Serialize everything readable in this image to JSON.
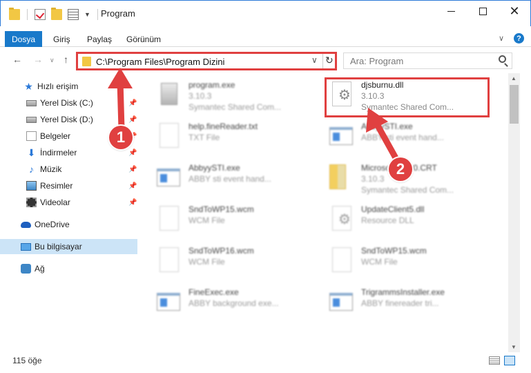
{
  "window": {
    "title": "Program",
    "minimize_label": "–",
    "maximize_label": "□",
    "close_label": "✕"
  },
  "ribbon": {
    "tabs": [
      {
        "label": "Dosya"
      },
      {
        "label": "Giriş"
      },
      {
        "label": "Paylaş"
      },
      {
        "label": "Görünüm"
      }
    ],
    "help_label": "?"
  },
  "nav": {
    "address": "C:\\Program Files\\Program Dizini",
    "search_placeholder": "Ara: Program"
  },
  "sidebar": {
    "items": [
      {
        "label": "Hızlı erişim",
        "icon": "star-icon"
      },
      {
        "label": "Yerel Disk (C:)",
        "icon": "disk-icon",
        "pinned": true
      },
      {
        "label": "Yerel Disk (D:)",
        "icon": "disk-icon",
        "pinned": true
      },
      {
        "label": "Belgeler",
        "icon": "document-icon",
        "pinned": true
      },
      {
        "label": "İndirmeler",
        "icon": "download-icon",
        "pinned": true
      },
      {
        "label": "Müzik",
        "icon": "music-icon",
        "pinned": true
      },
      {
        "label": "Resimler",
        "icon": "pictures-icon",
        "pinned": true
      },
      {
        "label": "Videolar",
        "icon": "videos-icon",
        "pinned": true
      },
      {
        "label": "OneDrive",
        "icon": "cloud-icon"
      },
      {
        "label": "Bu bilgisayar",
        "icon": "computer-icon",
        "selected": true
      },
      {
        "label": "Ağ",
        "icon": "network-icon"
      }
    ]
  },
  "files": [
    {
      "name": "program.exe",
      "line2": "3.10.3",
      "line3": "Symantec Shared Com...",
      "icon": "installer-icon"
    },
    {
      "name": "djsburnu.dll",
      "line2": "3.10.3",
      "line3": "Symantec Shared Com...",
      "icon": "dll-gear-icon",
      "highlighted": true
    },
    {
      "name": "help.fineReader.txt",
      "line2": "TXT File",
      "line3": "",
      "icon": "text-file-icon"
    },
    {
      "name": "AbbyySTI.exe",
      "line2": "ABBY sti event hand...",
      "line3": "",
      "icon": "exe-window-icon"
    },
    {
      "name": "AbbyySTI.exe",
      "line2": "ABBY sti event hand...",
      "line3": "",
      "icon": "exe-window-icon"
    },
    {
      "name": "Microsoft.VC90.CRT",
      "line2": "3.10.3",
      "line3": "Symantec Shared Com...",
      "icon": "folder-icon"
    },
    {
      "name": "SndToWP15.wcm",
      "line2": "WCM File",
      "line3": "",
      "icon": "blank-file-icon"
    },
    {
      "name": "UpdateClient5.dll",
      "line2": "Resource DLL",
      "line3": "",
      "icon": "dll-gear-icon"
    },
    {
      "name": "SndToWP16.wcm",
      "line2": "WCM File",
      "line3": "",
      "icon": "blank-file-icon"
    },
    {
      "name": "SndToWP15.wcm",
      "line2": "WCM File",
      "line3": "",
      "icon": "blank-file-icon"
    },
    {
      "name": "FineExec.exe",
      "line2": "ABBY background exe...",
      "line3": "",
      "icon": "exe-window-icon"
    },
    {
      "name": "TrigrammsInstaller.exe",
      "line2": "ABBY finereader tri...",
      "line3": "",
      "icon": "exe-window-icon"
    }
  ],
  "status": {
    "item_count": "115 öğe"
  },
  "annotations": {
    "step1": "1",
    "step2": "2",
    "color": "#e04040"
  }
}
